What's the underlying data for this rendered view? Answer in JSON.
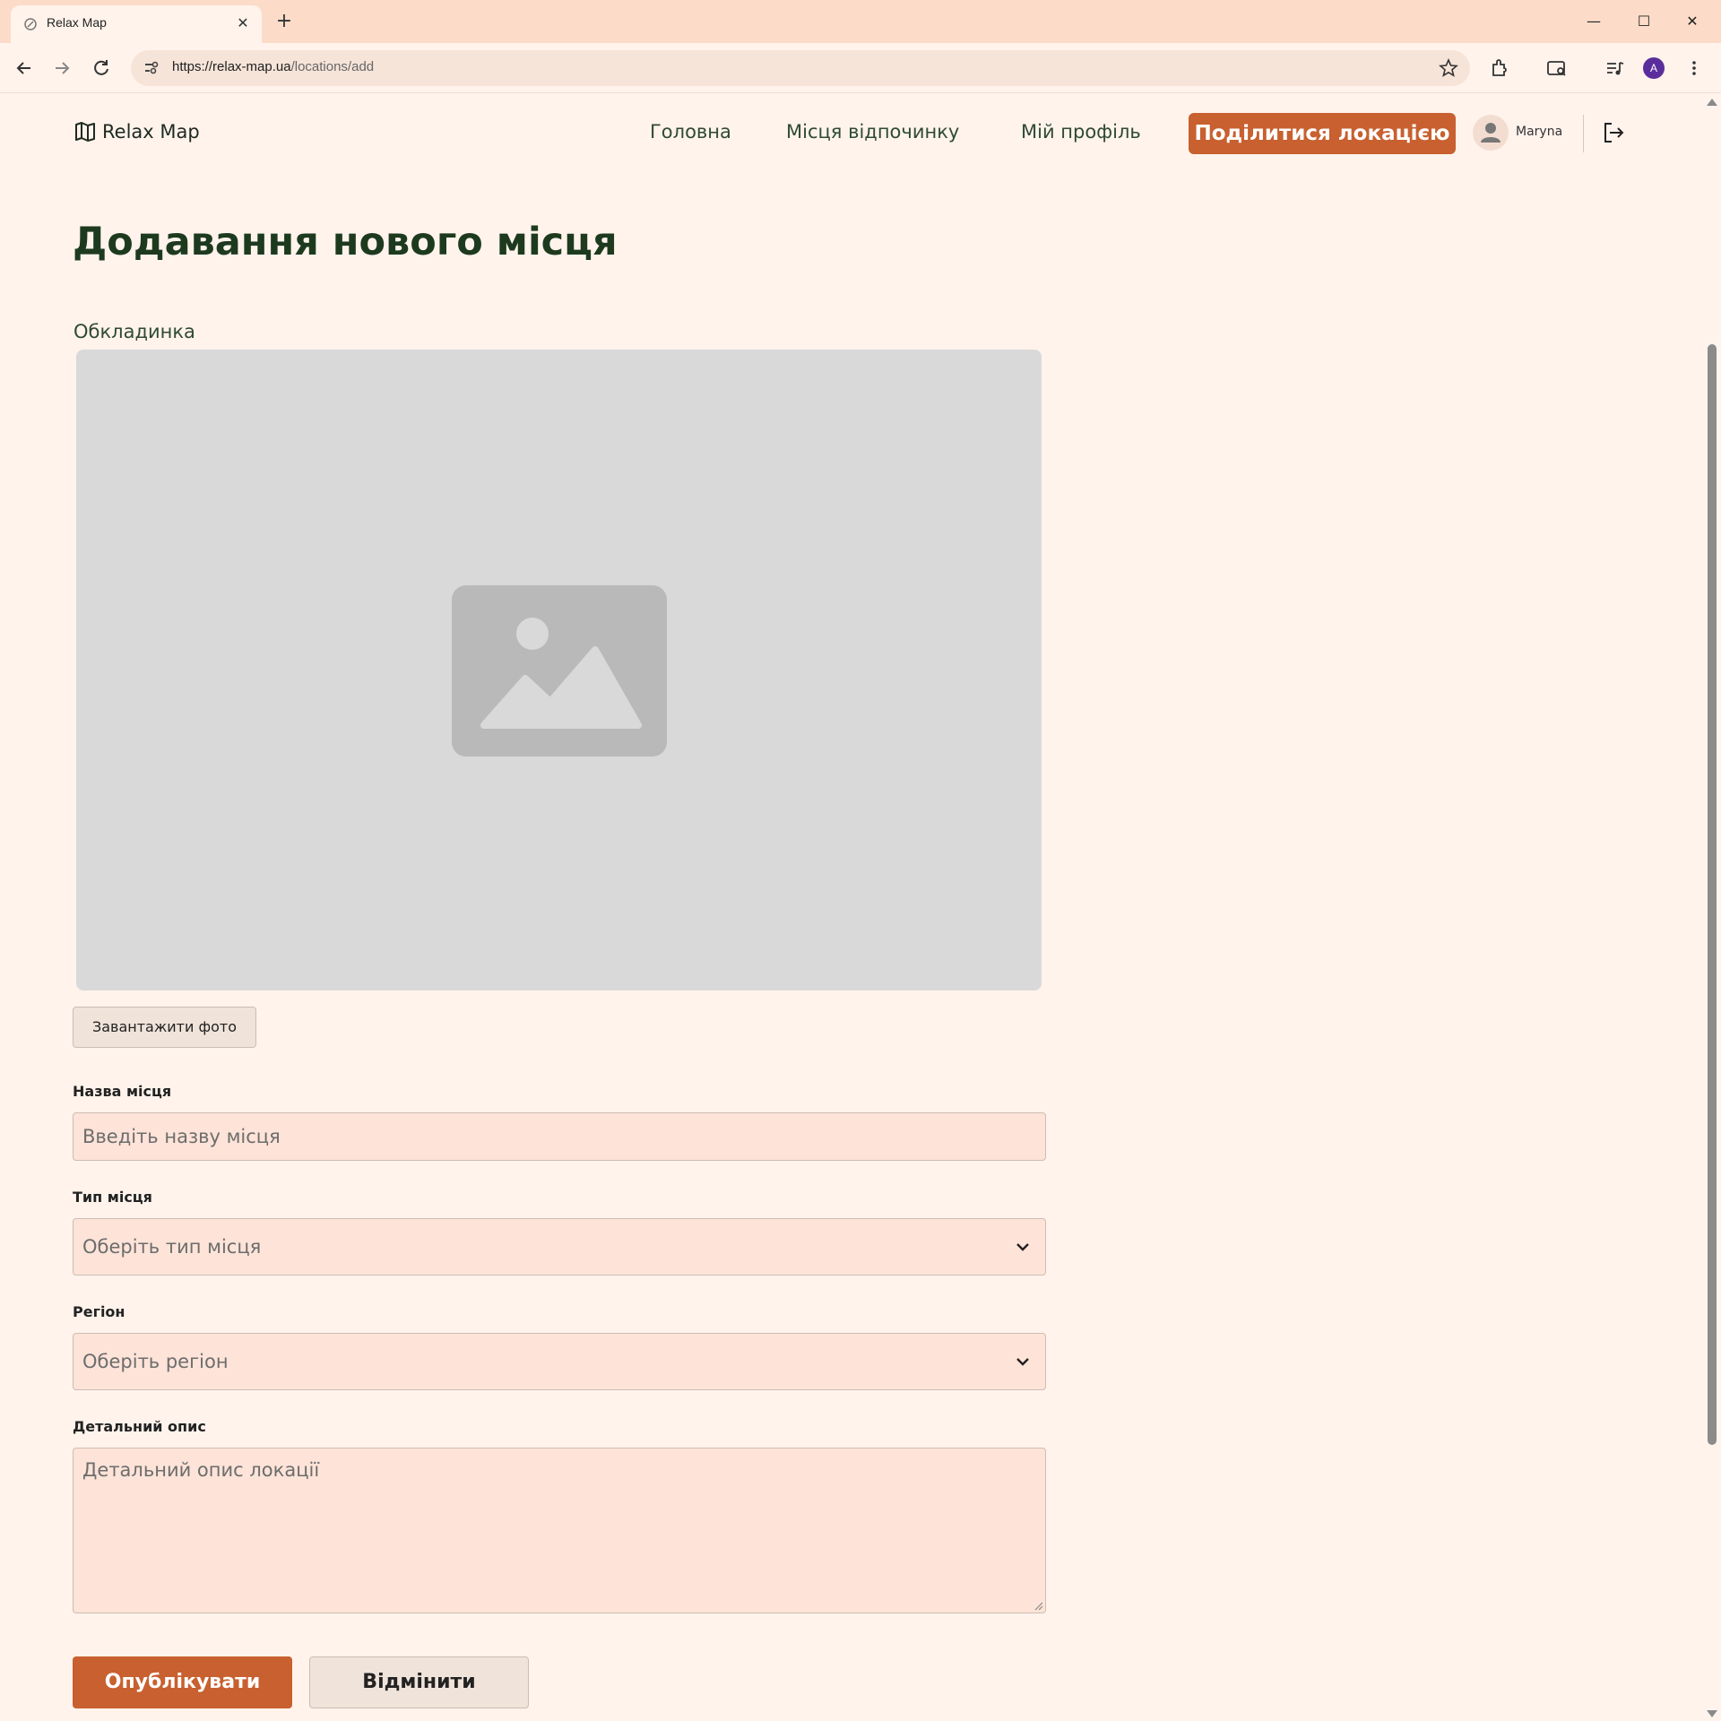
{
  "browser": {
    "tab_title": "Relax Map",
    "url_host": "https://relax-map.ua",
    "url_path": "/locations/add",
    "profile_initial": "A"
  },
  "header": {
    "logo_text": "Relax Map",
    "nav": [
      "Головна",
      "Місця відпочинку",
      "Мій профіль"
    ],
    "share_button": "Поділитися локацією",
    "user_name": "Maryna"
  },
  "form": {
    "title": "Додавання нового місця",
    "cover_label": "Обкладинка",
    "upload_button": "Завантажити фото",
    "name_label": "Назва місця",
    "name_placeholder": "Введіть назву місця",
    "type_label": "Тип місця",
    "type_placeholder": "Оберіть тип місця",
    "region_label": "Регіон",
    "region_placeholder": "Оберіть регіон",
    "description_label": "Детальний опис",
    "description_placeholder": "Детальний опис локації",
    "publish_button": "Опублікувати",
    "cancel_button": "Відмінити"
  },
  "colors": {
    "accent": "#c8602f",
    "page_bg": "#fff3ec",
    "heading": "#1d3a1f",
    "input_bg": "#fde3d8"
  },
  "icons": [
    "favicon-icon",
    "close-icon",
    "plus-icon",
    "minimize-icon",
    "maximize-icon",
    "back-icon",
    "forward-icon",
    "reload-icon",
    "site-info-icon",
    "star-icon",
    "extensions-icon",
    "search-tabs-icon",
    "media-icon",
    "menu-icon",
    "map-icon",
    "user-icon",
    "logout-icon",
    "image-placeholder-icon",
    "chevron-down-icon"
  ]
}
